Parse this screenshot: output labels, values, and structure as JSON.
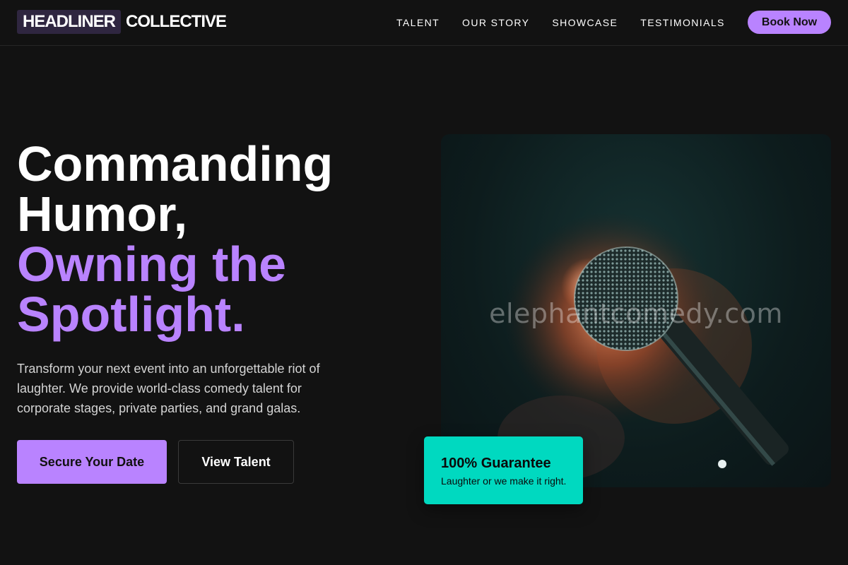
{
  "nav": {
    "logo_highlight": "HEADLINER",
    "logo_rest": "COLLECTIVE",
    "links": [
      "TALENT",
      "OUR STORY",
      "SHOWCASE",
      "TESTIMONIALS"
    ],
    "cta": "Book Now"
  },
  "hero": {
    "headline_lines": [
      "Commanding",
      "Humor,"
    ],
    "headline_accent_lines": [
      "Owning the",
      "Spotlight."
    ],
    "subtext": "Transform your next event into an unforgettable riot of laughter. We provide world-class comedy talent for corporate stages, private parties, and grand galas.",
    "primary_cta": "Secure Your Date",
    "secondary_cta": "View Talent",
    "image_icon": "microphone-image",
    "watermark": "elephantcomedy.com"
  },
  "badge": {
    "title": "100% Guarantee",
    "text": "Laughter or we make it right."
  },
  "colors": {
    "accent": "#b983ff",
    "background": "#121212",
    "badge": "#00d9c0"
  }
}
